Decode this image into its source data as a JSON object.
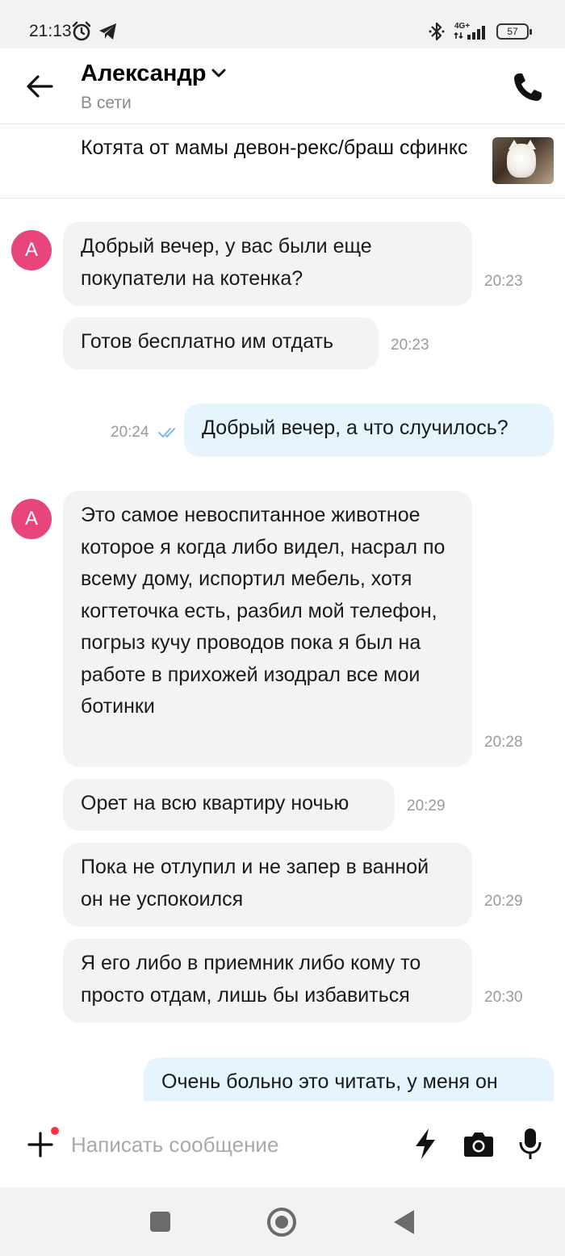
{
  "status_bar": {
    "time": "21:13",
    "network": "4G+",
    "battery": "57"
  },
  "header": {
    "name": "Александр",
    "status": "В сети"
  },
  "listing": {
    "title": "Котята от мамы девон-рекс/браш сфинкс"
  },
  "messages": [
    {
      "from": "them",
      "avatar": "А",
      "text": "Добрый вечер, у вас были еще покупатели на котенка?",
      "time": "20:23"
    },
    {
      "from": "them",
      "text": "Готов бесплатно им отдать",
      "time": "20:23"
    },
    {
      "from": "me",
      "text": "Добрый вечер, а что случилось?",
      "time": "20:24",
      "read": true
    },
    {
      "from": "them",
      "avatar": "А",
      "text": "Это самое невоспитанное животное которое я когда либо видел, насрал по всему дому, испортил мебель, хотя когтеточка есть, разбил мой телефон, погрыз кучу проводов пока я был на работе в прихожей изодрал все мои ботинки",
      "time": "20:28"
    },
    {
      "from": "them",
      "text": "Орет на всю квартиру ночью",
      "time": "20:29"
    },
    {
      "from": "them",
      "text": "Пока не отлупил и не запер в ванной он не успокоился",
      "time": "20:29"
    },
    {
      "from": "them",
      "text": "Я его либо в приемник либо кому то просто отдам, лишь бы избавиться",
      "time": "20:30"
    },
    {
      "from": "me",
      "text": "Очень больно это читать, у меня он",
      "time": ""
    }
  ],
  "composer": {
    "placeholder": "Написать сообщение",
    "value": ""
  },
  "colors": {
    "accent_avatar": "#e8457a",
    "incoming_bubble": "#f3f3f3",
    "outgoing_bubble": "#e6f4fd",
    "read_ticks": "#7ab8e8",
    "notification_dot": "#ff3344"
  },
  "icons": [
    "alarm-icon",
    "telegram-icon",
    "bluetooth-icon",
    "signal-icon",
    "battery-icon",
    "back-arrow-icon",
    "chevron-down-icon",
    "phone-icon",
    "read-ticks-icon",
    "plus-icon",
    "bolt-icon",
    "camera-icon",
    "mic-icon"
  ]
}
